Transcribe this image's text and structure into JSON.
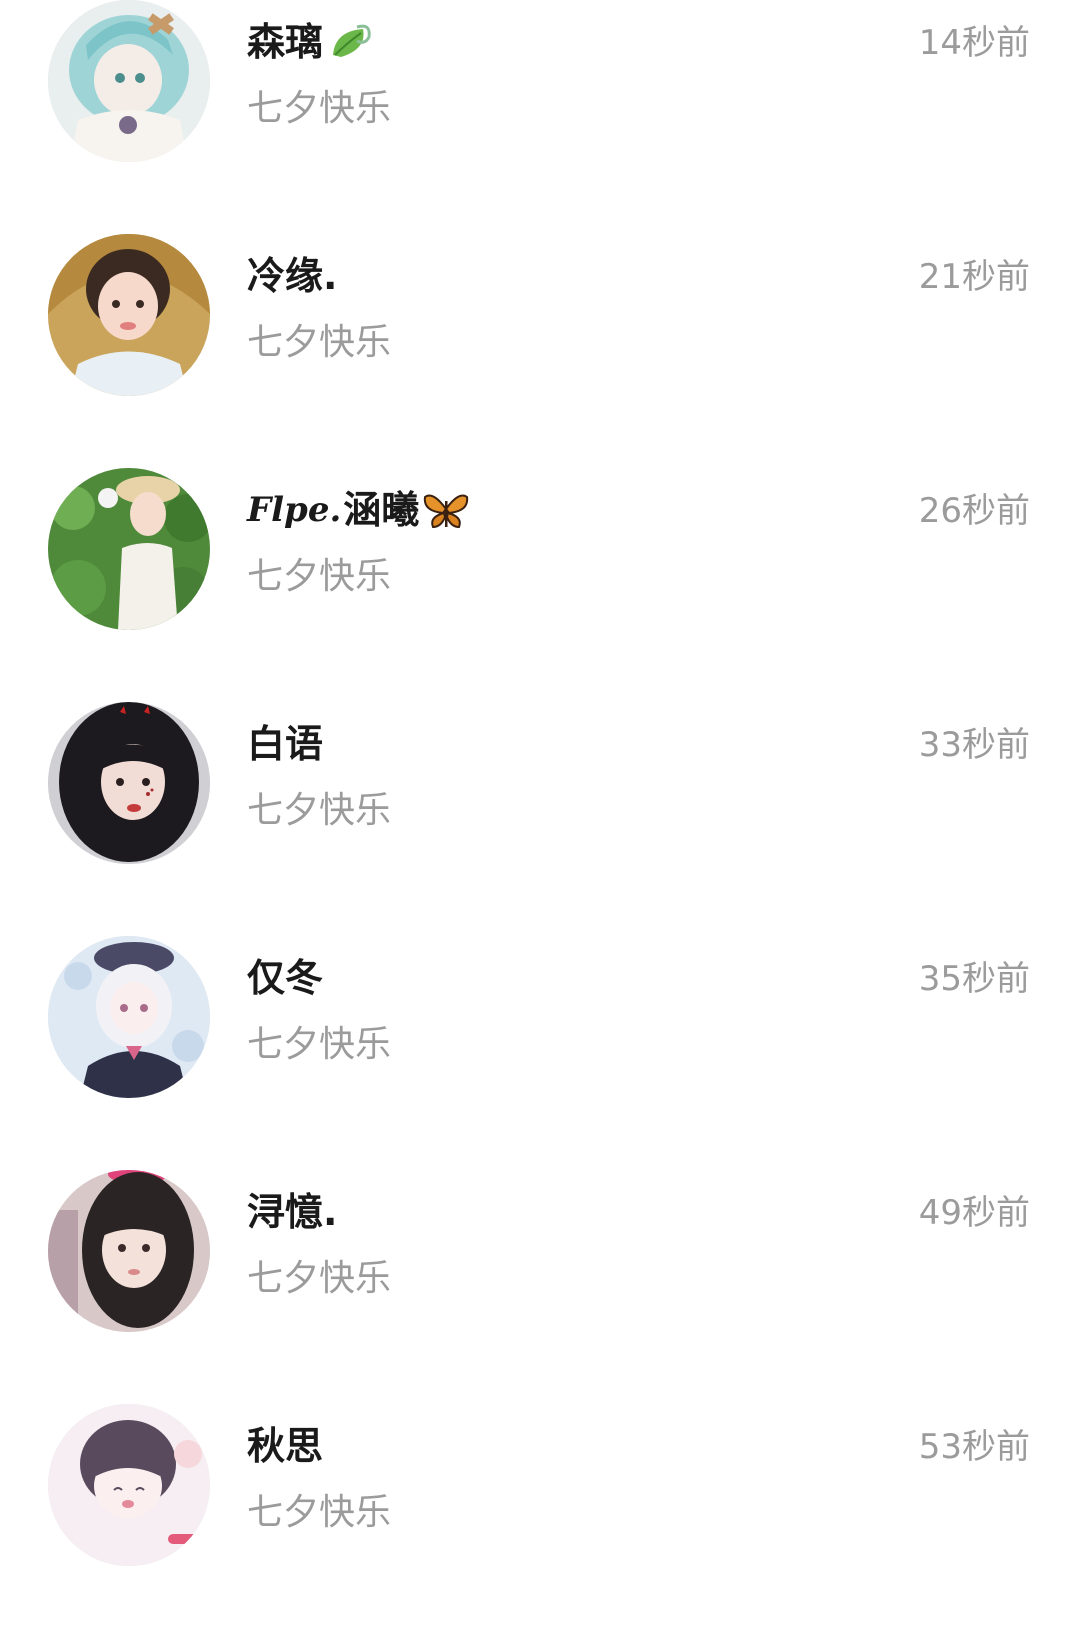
{
  "conversations": [
    {
      "name": "森璃",
      "name_prefix": "",
      "emoji": "leaf-icon",
      "message": "七夕快乐",
      "time": "14秒前",
      "avatar": "anime-girl-teal-hair-avatar"
    },
    {
      "name": "冷缘.",
      "name_prefix": "",
      "emoji": "",
      "message": "七夕快乐",
      "time": "21秒前",
      "avatar": "girl-in-straw-avatar"
    },
    {
      "name": "涵曦",
      "name_prefix": "Flpe.",
      "emoji": "butterfly-icon",
      "message": "七夕快乐",
      "time": "26秒前",
      "avatar": "girl-in-garden-avatar"
    },
    {
      "name": "白语",
      "name_prefix": "",
      "emoji": "",
      "message": "七夕快乐",
      "time": "33秒前",
      "avatar": "dark-hair-girl-avatar"
    },
    {
      "name": "仅冬",
      "name_prefix": "",
      "emoji": "",
      "message": "七夕快乐",
      "time": "35秒前",
      "avatar": "anime-white-hair-girl-avatar"
    },
    {
      "name": "浔憶.",
      "name_prefix": "",
      "emoji": "",
      "message": "七夕快乐",
      "time": "49秒前",
      "avatar": "girl-with-bangs-avatar"
    },
    {
      "name": "秋思",
      "name_prefix": "",
      "emoji": "",
      "message": "七夕快乐",
      "time": "53秒前",
      "avatar": "anime-chibi-girl-avatar"
    }
  ],
  "colors": {
    "name": "#1a1a1a",
    "secondary": "#9b9b9b",
    "background": "#ffffff"
  }
}
